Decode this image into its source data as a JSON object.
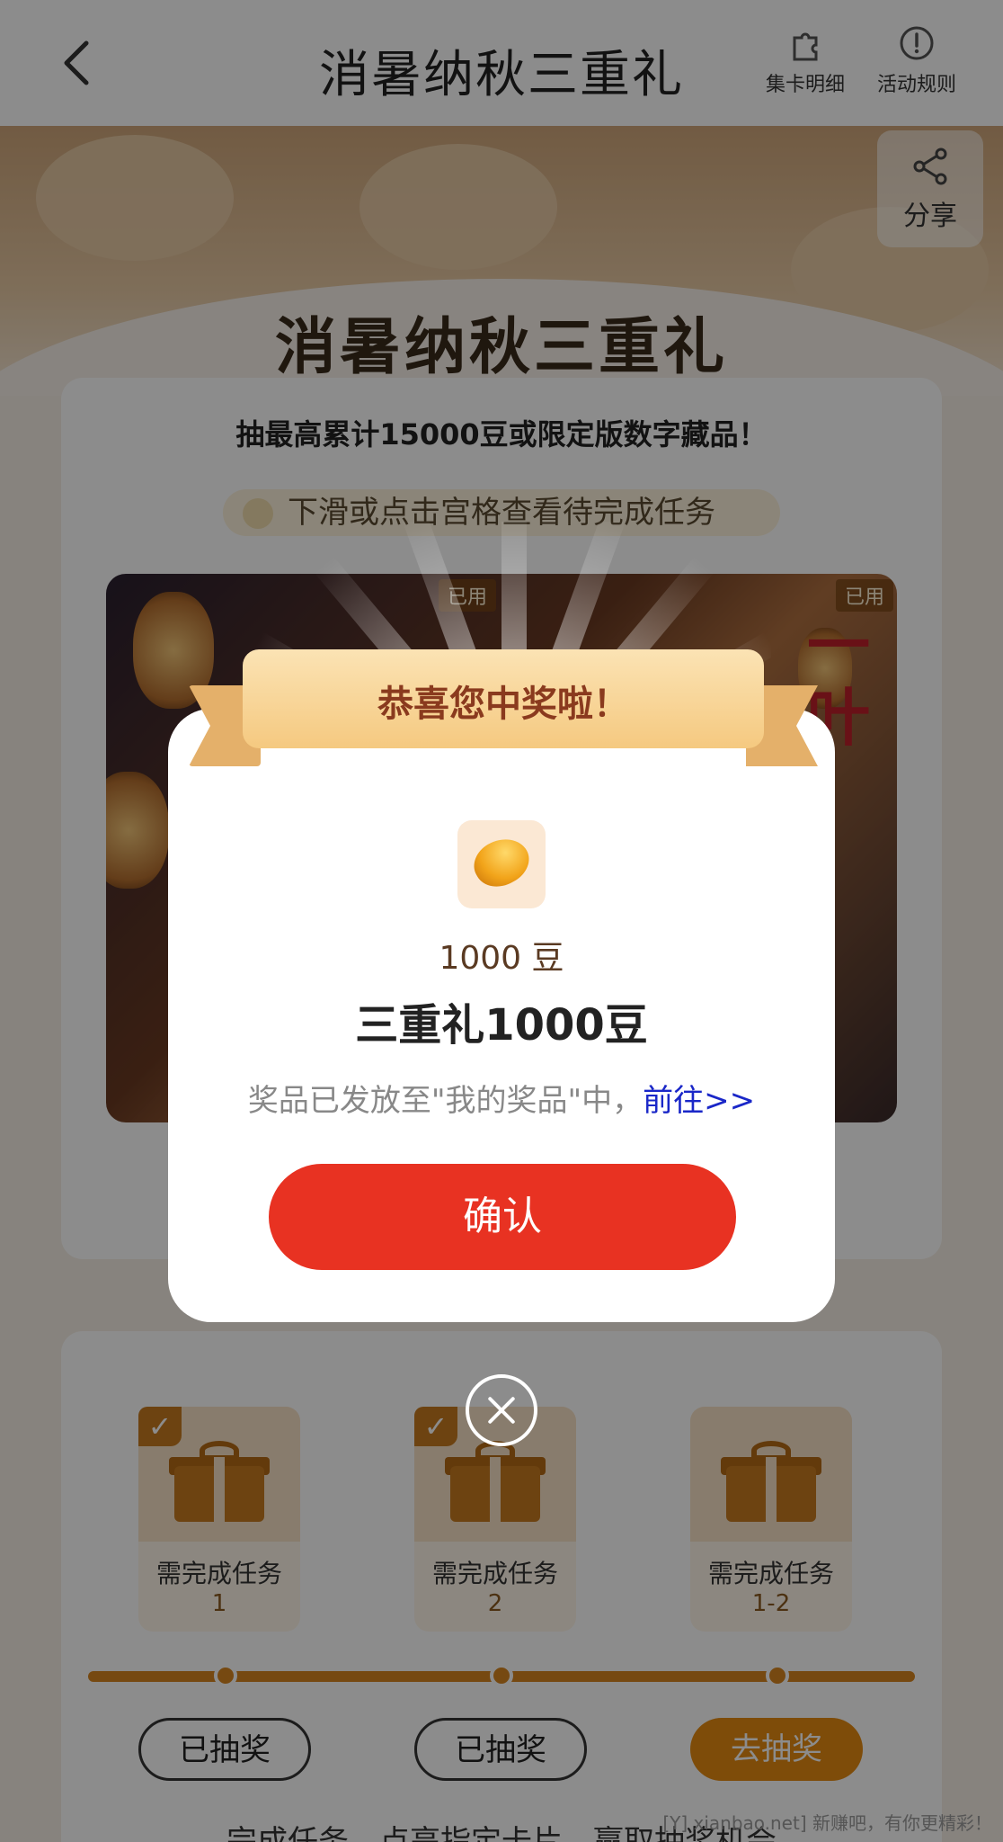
{
  "header": {
    "title": "消暑纳秋三重礼",
    "actions": [
      {
        "label": "集卡明细",
        "icon": "puzzle-icon"
      },
      {
        "label": "活动规则",
        "icon": "info-icon"
      }
    ]
  },
  "hero": {
    "title": "消暑纳秋三重礼",
    "share_label": "分享"
  },
  "main": {
    "subtitle": "抽最高累计15000豆或限定版数字藏品！",
    "hint": "下滑或点击宫格查看待完成任务",
    "used_tags": [
      "已用",
      "已用"
    ],
    "calligraphy": "一叶"
  },
  "tasks": {
    "items": [
      {
        "label": "需完成任务",
        "num": "1",
        "completed": true,
        "button": "已抽奖"
      },
      {
        "label": "需完成任务",
        "num": "2",
        "completed": true,
        "button": "已抽奖"
      },
      {
        "label": "需完成任务",
        "num": "1-2",
        "completed": false,
        "button": "去抽奖"
      }
    ],
    "footer": "完成任务，点亮指定卡片，赢取抽奖机会"
  },
  "modal": {
    "banner": "恭喜您中奖啦！",
    "prize_icon": "bean-icon",
    "prize_amount": "1000 豆",
    "prize_name": "三重礼1000豆",
    "note_prefix": "奖品已发放至\"我的奖品\"中，",
    "note_link": "前往>>",
    "confirm": "确认"
  },
  "watermark": "[Y] xianbao.net] 新赚吧，有你更精彩！",
  "colors": {
    "confirm": "#e83222",
    "accent": "#d78520",
    "link": "#1a27c8"
  }
}
